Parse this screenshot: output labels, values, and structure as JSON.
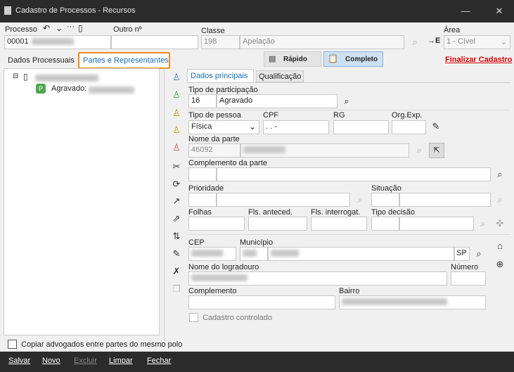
{
  "window": {
    "title": "Cadastro de Processos - Recursos"
  },
  "header": {
    "processo_label": "Processo",
    "processo_value": "00001",
    "outro_label": "Outro nº",
    "classe_label": "Classe",
    "classe_code": "198",
    "classe_name": "Apelação",
    "area_label": "Área",
    "area_value": "1 - Cível"
  },
  "tabs": {
    "dados_processuais": "Dados Processuais",
    "partes": "Partes e Representantes",
    "rapido": "Rápido",
    "completo": "Completo",
    "finalizar": "Finalizar Cadastro"
  },
  "tree": {
    "child_label": "Agravado:"
  },
  "subtabs": {
    "principais": "Dados principais",
    "qualificacao": "Qualificação"
  },
  "form": {
    "tipo_participacao_label": "Tipo de participação",
    "tipo_participacao_code": "16",
    "tipo_participacao_name": "Agravado",
    "tipo_pessoa_label": "Tipo de pessoa",
    "tipo_pessoa_value": "Física",
    "cpf_label": "CPF",
    "cpf_value": " .   .   -",
    "rg_label": "RG",
    "orgexp_label": "Org.Exp.",
    "nome_parte_label": "Nome da parte",
    "nome_parte_code": "46092",
    "complemento_parte_label": "Complemento da parte",
    "prioridade_label": "Prioridade",
    "situacao_label": "Situação",
    "folhas_label": "Folhas",
    "fls_anteced_label": "Fls. anteced.",
    "fls_interrog_label": "Fls. interrogat.",
    "tipo_decisao_label": "Tipo decisão",
    "cep_label": "CEP",
    "municipio_label": "Município",
    "uf_value": "SP",
    "logradouro_label": "Nome do logradouro",
    "numero_label": "Número",
    "complemento_label": "Complemento",
    "bairro_label": "Bairro",
    "cadastro_controlado_label": "Cadastro controlado"
  },
  "footer": {
    "copiar_label": "Copiar advogados entre partes do mesmo polo",
    "salvar": "Salvar",
    "novo": "Novo",
    "excluir": "Excluir",
    "limpar": "Limpar",
    "fechar": "Fechar"
  },
  "colors": {
    "accent": "#1a6fb5",
    "finalizar": "#e00000",
    "tab_highlight": "#f08a1c",
    "titlebar": "#2b2b2b"
  }
}
